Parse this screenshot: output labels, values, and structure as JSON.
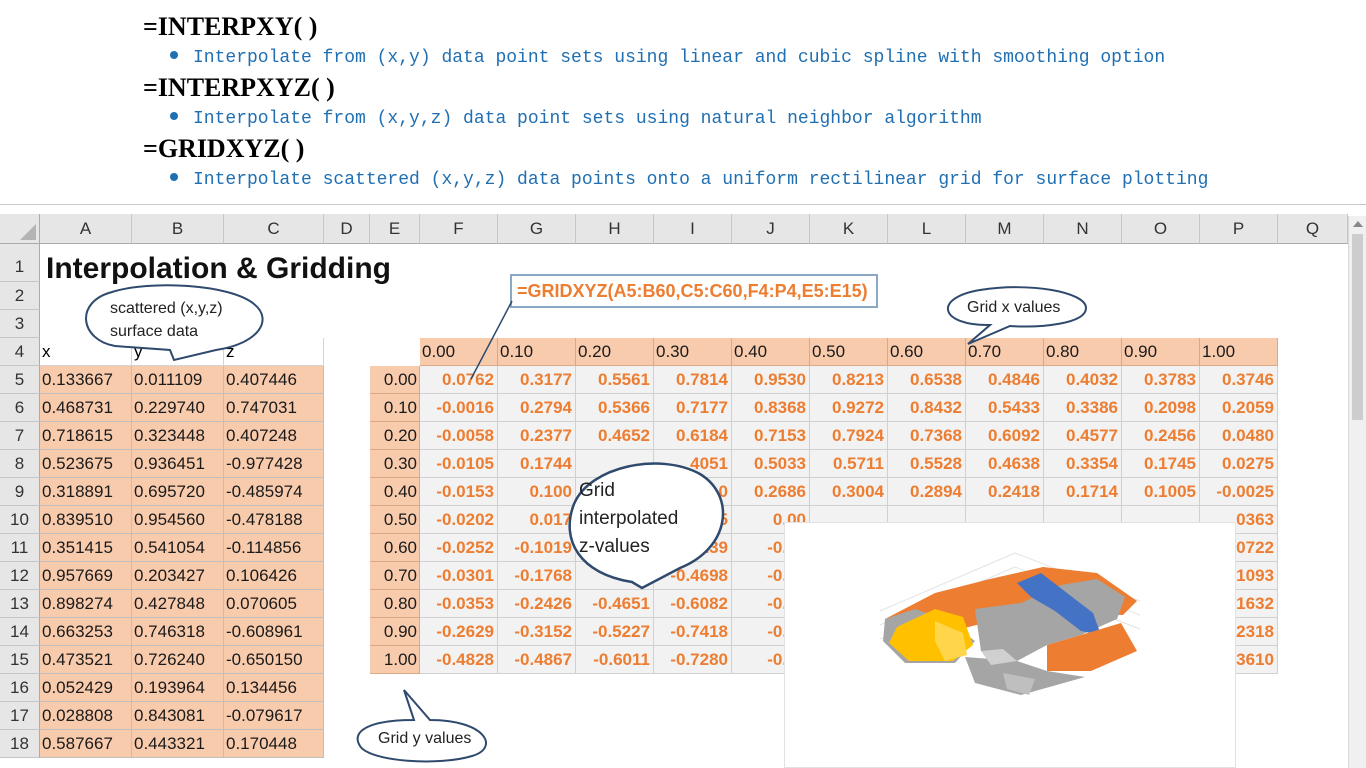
{
  "header": {
    "functions": [
      {
        "name": "=INTERPXY( )",
        "description": "Interpolate from (x,y) data point sets using linear and cubic spline with smoothing option"
      },
      {
        "name": "=INTERPXYZ( )",
        "description": "Interpolate from (x,y,z) data point sets using natural neighbor algorithm"
      },
      {
        "name": "=GRIDXYZ( )",
        "description": "Interpolate scattered (x,y,z) data points onto a uniform rectilinear grid for surface plotting"
      }
    ]
  },
  "sheet": {
    "columns": [
      "A",
      "B",
      "C",
      "D",
      "E",
      "F",
      "G",
      "H",
      "I",
      "J",
      "K",
      "L",
      "M",
      "N",
      "O",
      "P",
      "Q"
    ],
    "rows": [
      "1",
      "2",
      "3",
      "4",
      "5",
      "6",
      "7",
      "8",
      "9",
      "10",
      "11",
      "12",
      "13",
      "14",
      "15",
      "16",
      "17",
      "18"
    ],
    "title": "Interpolation & Gridding",
    "formula": "=GRIDXYZ(A5:B60,C5:C60,F4:P4,E5:E15)",
    "scatter_headers": [
      "x",
      "y",
      "z"
    ],
    "scatter": [
      [
        "0.133667",
        "0.011109",
        "0.407446"
      ],
      [
        "0.468731",
        "0.229740",
        "0.747031"
      ],
      [
        "0.718615",
        "0.323448",
        "0.407248"
      ],
      [
        "0.523675",
        "0.936451",
        "-0.977428"
      ],
      [
        "0.318891",
        "0.695720",
        "-0.485974"
      ],
      [
        "0.839510",
        "0.954560",
        "-0.478188"
      ],
      [
        "0.351415",
        "0.541054",
        "-0.114856"
      ],
      [
        "0.957669",
        "0.203427",
        "0.106426"
      ],
      [
        "0.898274",
        "0.427848",
        "0.070605"
      ],
      [
        "0.663253",
        "0.746318",
        "-0.608961"
      ],
      [
        "0.473521",
        "0.726240",
        "-0.650150"
      ],
      [
        "0.052429",
        "0.193964",
        "0.134456"
      ],
      [
        "0.028808",
        "0.843081",
        "-0.079617"
      ],
      [
        "0.587667",
        "0.443321",
        "0.170448"
      ]
    ],
    "grid_x": [
      "0.00",
      "0.10",
      "0.20",
      "0.30",
      "0.40",
      "0.50",
      "0.60",
      "0.70",
      "0.80",
      "0.90",
      "1.00"
    ],
    "grid_y": [
      "0.00",
      "0.10",
      "0.20",
      "0.30",
      "0.40",
      "0.50",
      "0.60",
      "0.70",
      "0.80",
      "0.90",
      "1.00"
    ],
    "grid_z": [
      [
        "0.0762",
        "0.3177",
        "0.5561",
        "0.7814",
        "0.9530",
        "0.8213",
        "0.6538",
        "0.4846",
        "0.4032",
        "0.3783",
        "0.3746"
      ],
      [
        "-0.0016",
        "0.2794",
        "0.5366",
        "0.7177",
        "0.8368",
        "0.9272",
        "0.8432",
        "0.5433",
        "0.3386",
        "0.2098",
        "0.2059"
      ],
      [
        "-0.0058",
        "0.2377",
        "0.4652",
        "0.6184",
        "0.7153",
        "0.7924",
        "0.7368",
        "0.6092",
        "0.4577",
        "0.2456",
        "0.0480"
      ],
      [
        "-0.0105",
        "0.1744",
        "",
        "4051",
        "0.5033",
        "0.5711",
        "0.5528",
        "0.4638",
        "0.3354",
        "0.1745",
        "0.0275"
      ],
      [
        "-0.0153",
        "0.100",
        "",
        "0",
        "0.2686",
        "0.3004",
        "0.2894",
        "0.2418",
        "0.1714",
        "0.1005",
        "-0.0025"
      ],
      [
        "-0.0202",
        "0.017",
        "",
        "5",
        "0.00",
        "",
        "",
        "",
        "",
        "",
        "0363"
      ],
      [
        "-0.0252",
        "-0.1019",
        "",
        "239",
        "-0.27",
        "",
        "",
        "",
        "",
        "",
        "0722"
      ],
      [
        "-0.0301",
        "-0.1768",
        "-0.34",
        "-0.4698",
        "-0.54",
        "",
        "",
        "",
        "",
        "",
        "1093"
      ],
      [
        "-0.0353",
        "-0.2426",
        "-0.4651",
        "-0.6082",
        "-0.71",
        "",
        "",
        "",
        "",
        "",
        "1632"
      ],
      [
        "-0.2629",
        "-0.3152",
        "-0.5227",
        "-0.7418",
        "-0.86",
        "",
        "",
        "",
        "",
        "",
        "2318"
      ],
      [
        "-0.4828",
        "-0.4867",
        "-0.6011",
        "-0.7280",
        "-0.81",
        "",
        "",
        "",
        "",
        "",
        "3610"
      ]
    ],
    "callouts": {
      "scattered": [
        "scattered (x,y,z)",
        "surface data"
      ],
      "grid_x": "Grid x values",
      "grid_y": "Grid y values",
      "grid_z": [
        "Grid",
        "interpolated",
        "z-values"
      ]
    }
  },
  "colors": {
    "accent_text": "#1f6fb2",
    "value_orange": "#ed7d31",
    "cell_fill": "#f8cbad",
    "callout_stroke": "#2f4a6d",
    "surface_orange": "#ed7d31",
    "surface_gray": "#a5a5a5",
    "surface_yellow": "#ffc000",
    "surface_blue": "#4472c4"
  }
}
